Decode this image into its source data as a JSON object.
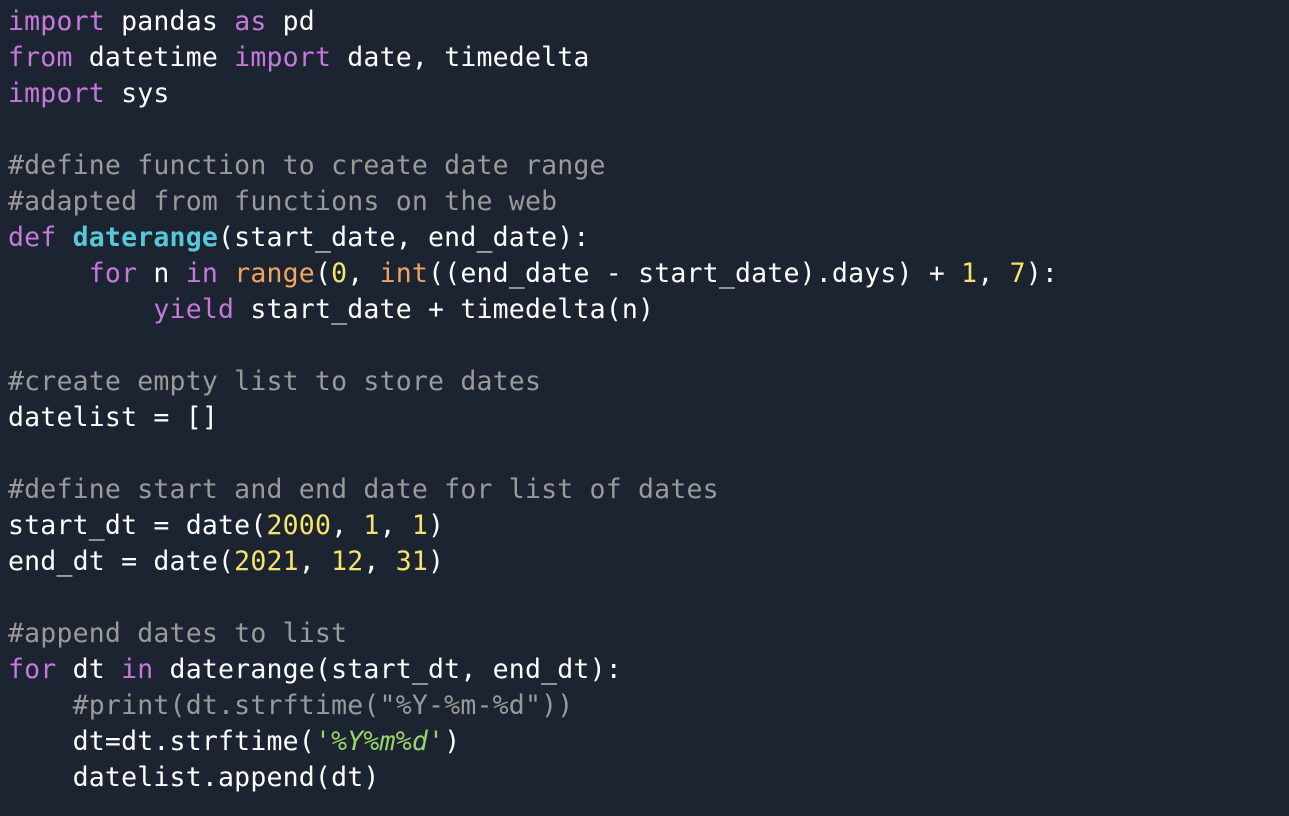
{
  "editor": {
    "lines": [
      [
        {
          "t": "import",
          "c": "kw"
        },
        {
          "t": " pandas ",
          "c": ""
        },
        {
          "t": "as",
          "c": "kw"
        },
        {
          "t": " pd",
          "c": ""
        }
      ],
      [
        {
          "t": "from",
          "c": "kw"
        },
        {
          "t": " datetime ",
          "c": ""
        },
        {
          "t": "import",
          "c": "kw"
        },
        {
          "t": " date, timedelta",
          "c": ""
        }
      ],
      [
        {
          "t": "import",
          "c": "kw"
        },
        {
          "t": " sys",
          "c": ""
        }
      ],
      [],
      [
        {
          "t": "#define function to create date range",
          "c": "cm"
        }
      ],
      [
        {
          "t": "#adapted from functions on the web",
          "c": "cm"
        }
      ],
      [
        {
          "t": "def",
          "c": "kw"
        },
        {
          "t": " ",
          "c": ""
        },
        {
          "t": "daterange",
          "c": "fn"
        },
        {
          "t": "(start_date, end_date):",
          "c": ""
        }
      ],
      [
        {
          "t": "     ",
          "c": ""
        },
        {
          "t": "for",
          "c": "kw"
        },
        {
          "t": " n ",
          "c": ""
        },
        {
          "t": "in",
          "c": "kw"
        },
        {
          "t": " ",
          "c": ""
        },
        {
          "t": "range",
          "c": "bi"
        },
        {
          "t": "(",
          "c": ""
        },
        {
          "t": "0",
          "c": "num"
        },
        {
          "t": ", ",
          "c": ""
        },
        {
          "t": "int",
          "c": "bi"
        },
        {
          "t": "((end_date - start_date).days) + ",
          "c": ""
        },
        {
          "t": "1",
          "c": "num"
        },
        {
          "t": ", ",
          "c": ""
        },
        {
          "t": "7",
          "c": "num"
        },
        {
          "t": "):",
          "c": ""
        }
      ],
      [
        {
          "t": "         ",
          "c": ""
        },
        {
          "t": "yield",
          "c": "kw"
        },
        {
          "t": " start_date + timedelta(n)",
          "c": ""
        }
      ],
      [],
      [
        {
          "t": "#create empty list to store dates",
          "c": "cm"
        }
      ],
      [
        {
          "t": "datelist = []",
          "c": ""
        }
      ],
      [],
      [
        {
          "t": "#define start and end date for list of dates",
          "c": "cm"
        }
      ],
      [
        {
          "t": "start_dt = date(",
          "c": ""
        },
        {
          "t": "2000",
          "c": "num"
        },
        {
          "t": ", ",
          "c": ""
        },
        {
          "t": "1",
          "c": "num"
        },
        {
          "t": ", ",
          "c": ""
        },
        {
          "t": "1",
          "c": "num"
        },
        {
          "t": ")",
          "c": ""
        }
      ],
      [
        {
          "t": "end_dt = date(",
          "c": ""
        },
        {
          "t": "2021",
          "c": "num"
        },
        {
          "t": ", ",
          "c": ""
        },
        {
          "t": "12",
          "c": "num"
        },
        {
          "t": ", ",
          "c": ""
        },
        {
          "t": "31",
          "c": "num"
        },
        {
          "t": ")",
          "c": ""
        }
      ],
      [],
      [
        {
          "t": "#append dates to list",
          "c": "cm"
        }
      ],
      [
        {
          "t": "for",
          "c": "kw"
        },
        {
          "t": " dt ",
          "c": ""
        },
        {
          "t": "in",
          "c": "kw"
        },
        {
          "t": " daterange(start_dt, end_dt):",
          "c": ""
        }
      ],
      [
        {
          "t": "    ",
          "c": ""
        },
        {
          "t": "#print(dt.strftime(\"%Y-%m-%d\"))",
          "c": "cm"
        }
      ],
      [
        {
          "t": "    dt=dt.strftime(",
          "c": ""
        },
        {
          "t": "'%Y%m%d'",
          "c": "str"
        },
        {
          "t": ")",
          "c": ""
        }
      ],
      [
        {
          "t": "    datelist.append(dt)",
          "c": ""
        }
      ]
    ]
  }
}
